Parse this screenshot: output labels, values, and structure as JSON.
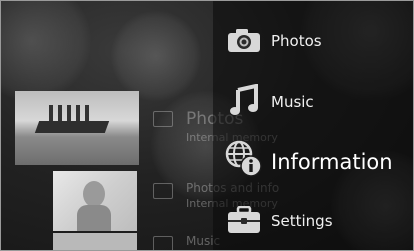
{
  "menu": {
    "items": [
      {
        "label": "Photos",
        "icon": "camera-icon"
      },
      {
        "label": "Music",
        "icon": "music-note-icon"
      },
      {
        "label": "Information",
        "icon": "globe-info-icon",
        "selected": true
      },
      {
        "label": "Settings",
        "icon": "toolbox-icon"
      }
    ]
  },
  "content_list": {
    "items": [
      {
        "title": "Photos",
        "subtitle": "Internal memory"
      },
      {
        "title": "Photos and info",
        "subtitle": "Internal memory"
      },
      {
        "title": "Music"
      }
    ]
  }
}
